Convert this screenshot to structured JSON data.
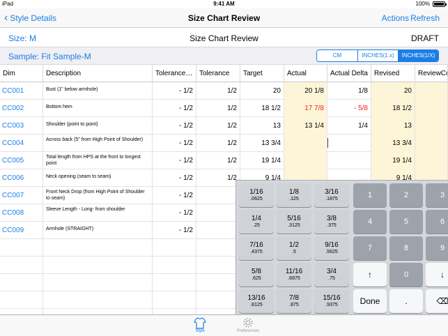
{
  "status_bar": {
    "carrier": "iPad",
    "time": "9:41 AM",
    "battery": "100%"
  },
  "nav": {
    "back_label": "Style Details",
    "title": "Size Chart Review",
    "actions_label": "Actions",
    "refresh_label": "Refresh"
  },
  "info": {
    "size": "Size: M",
    "center_title": "Size Chart Review",
    "status": "DRAFT",
    "sample": "Sample: Fit Sample-M"
  },
  "units": {
    "options": [
      "CM",
      "INCHES(1.x)",
      "INCHES(1/X)"
    ],
    "selected": "INCHES(1/X)"
  },
  "table": {
    "headers": [
      "Dim",
      "Description",
      "Tolerance…",
      "Tolerance",
      "Target",
      "Actual",
      "Actual Delta",
      "Revised",
      "ReviewCo"
    ],
    "rows": [
      {
        "dim": "CC001",
        "desc": "Bust (1\" below armhole)",
        "tol_minus": "- 1/2",
        "tol_plus": "1/2",
        "target": "20",
        "actual": "20 1/8",
        "delta": "1/8",
        "revised": "20",
        "actual_red": false
      },
      {
        "dim": "CC002",
        "desc": "Bottom hem",
        "tol_minus": "- 1/2",
        "tol_plus": "1/2",
        "target": "18 1/2",
        "actual": "17 7/8",
        "delta": "- 5/8",
        "revised": "18 1/2",
        "actual_red": true
      },
      {
        "dim": "CC003",
        "desc": "Shoulder (point to point)",
        "tol_minus": "- 1/2",
        "tol_plus": "1/2",
        "target": "13",
        "actual": "13 1/4",
        "delta": "1/4",
        "revised": "13",
        "actual_red": false
      },
      {
        "dim": "CC004",
        "desc": "Across back (5\" from High Point of Shoulder)",
        "tol_minus": "- 1/2",
        "tol_plus": "1/2",
        "target": "13 3/4",
        "actual": "",
        "delta": "",
        "revised": "13 3/4",
        "actual_red": false
      },
      {
        "dim": "CC005",
        "desc": "Total length from HPS at the front to longest point",
        "tol_minus": "- 1/2",
        "tol_plus": "1/2",
        "target": "19 1/4",
        "actual": "",
        "delta": "",
        "revised": "19 1/4",
        "actual_red": false
      },
      {
        "dim": "CC006",
        "desc": "Neck opening (seam to seam)",
        "tol_minus": "- 1/2",
        "tol_plus": "1/2",
        "target": "9 1/4",
        "actual": "",
        "delta": "",
        "revised": "9 1/4",
        "actual_red": false
      },
      {
        "dim": "CC007",
        "desc": "Front Neck Drop (from High Point of Shoulder to seam)",
        "tol_minus": "- 1/2",
        "tol_plus": "",
        "target": "",
        "actual": "",
        "delta": "",
        "revised": "",
        "actual_red": false
      },
      {
        "dim": "CC008",
        "desc": "Sleeve Length - Long- from shoulder",
        "tol_minus": "- 1/2",
        "tol_plus": "",
        "target": "",
        "actual": "",
        "delta": "",
        "revised": "",
        "actual_red": false
      },
      {
        "dim": "CC009",
        "desc": "Armhole (STRAIGHT)",
        "tol_minus": "- 1/2",
        "tol_plus": "",
        "target": "",
        "actual": "",
        "delta": "",
        "revised": "",
        "actual_red": false
      }
    ]
  },
  "keypad": {
    "fractions": [
      [
        "1/16",
        ".0625"
      ],
      [
        "1/8",
        ".125"
      ],
      [
        "3/16",
        ".1875"
      ],
      [
        "1/4",
        ".25"
      ],
      [
        "5/16",
        ".3125"
      ],
      [
        "3/8",
        ".375"
      ],
      [
        "7/16",
        ".4375"
      ],
      [
        "1/2",
        ".5"
      ],
      [
        "9/16",
        ".5625"
      ],
      [
        "5/8",
        ".625"
      ],
      [
        "11/16",
        ".6875"
      ],
      [
        "3/4",
        ".75"
      ],
      [
        "13/16",
        ".8125"
      ],
      [
        "7/8",
        ".875"
      ],
      [
        "15/16",
        ".9375"
      ]
    ],
    "digits": [
      "1",
      "2",
      "3",
      "4",
      "5",
      "6",
      "7",
      "8",
      "9",
      "↑",
      "0",
      "↓",
      "Done",
      ".",
      "⌫"
    ]
  },
  "tabs": [
    {
      "label": "Style",
      "icon": "shirt-icon",
      "active": true
    },
    {
      "label": "Preferences",
      "icon": "gear-icon",
      "active": false
    }
  ]
}
